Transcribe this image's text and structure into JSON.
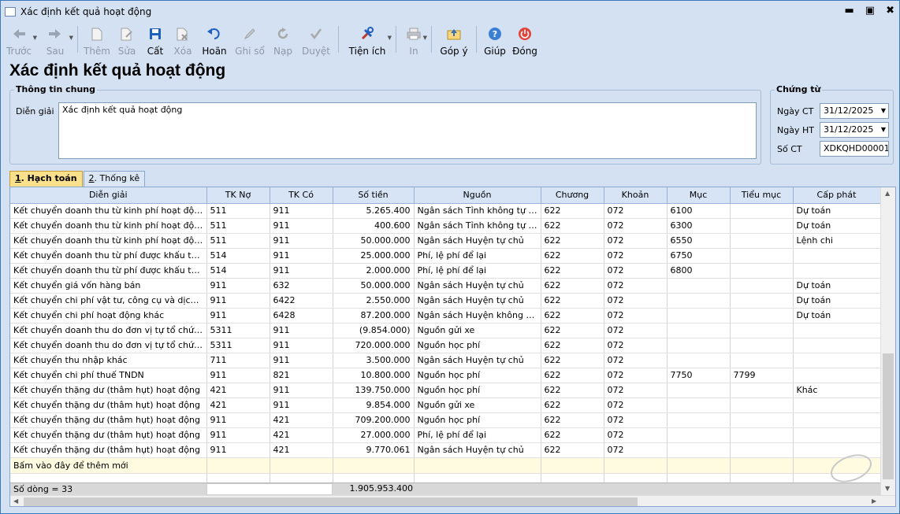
{
  "window": {
    "title": "Xác định kết quả hoạt động"
  },
  "toolbar": {
    "back": "Trước",
    "next": "Sau",
    "add": "Thêm",
    "edit": "Sửa",
    "save": "Cất",
    "delete": "Xóa",
    "undo": "Hoãn",
    "post": "Ghi sổ",
    "load": "Nạp",
    "approve": "Duyệt",
    "utilities": "Tiện ích",
    "print": "In",
    "feedback": "Góp ý",
    "help": "Giúp",
    "close": "Đóng"
  },
  "page": {
    "title": "Xác định kết quả hoạt động"
  },
  "general": {
    "legend": "Thông tin chung",
    "desc_label": "Diễn giải",
    "desc_value": "Xác định kết quả hoạt động"
  },
  "voucher": {
    "legend": "Chứng từ",
    "date_ct_label": "Ngày CT",
    "date_ct": "31/12/2025",
    "date_ht_label": "Ngày HT",
    "date_ht": "31/12/2025",
    "no_label": "Số CT",
    "no": "XDKQHD00001"
  },
  "tabs": [
    {
      "key": "1",
      "label": ". Hạch toán"
    },
    {
      "key": "2",
      "label": ". Thống kê"
    }
  ],
  "grid": {
    "columns": [
      "Diễn giải",
      "TK Nợ",
      "TK Có",
      "Số tiền",
      "Nguồn",
      "Chương",
      "Khoản",
      "Mục",
      "Tiểu mục",
      "Cấp phát"
    ],
    "rows": [
      [
        "Kết chuyển doanh thu từ kinh phí hoạt động N...",
        "511",
        "911",
        "5.265.400",
        "Ngân sách Tỉnh không tự chủ",
        "622",
        "072",
        "6100",
        "",
        "Dự toán"
      ],
      [
        "Kết chuyển doanh thu từ kinh phí hoạt động N...",
        "511",
        "911",
        "400.600",
        "Ngân sách Tỉnh không tự chủ",
        "622",
        "072",
        "6300",
        "",
        "Dự toán"
      ],
      [
        "Kết chuyển doanh thu từ kinh phí hoạt động N...",
        "511",
        "911",
        "50.000.000",
        "Ngân sách Huyện tự chủ",
        "622",
        "072",
        "6550",
        "",
        "Lệnh chi"
      ],
      [
        "Kết chuyển doanh thu từ phí được khấu trừ, để...",
        "514",
        "911",
        "25.000.000",
        "Phí, lệ phí để lại",
        "622",
        "072",
        "6750",
        "",
        ""
      ],
      [
        "Kết chuyển doanh thu từ phí được khấu trừ, để...",
        "514",
        "911",
        "2.000.000",
        "Phí, lệ phí để lại",
        "622",
        "072",
        "6800",
        "",
        ""
      ],
      [
        "Kết chuyển giá vốn hàng bán",
        "911",
        "632",
        "50.000.000",
        "Ngân sách Huyện tự chủ",
        "622",
        "072",
        "",
        "",
        "Dự toán"
      ],
      [
        "Kết chuyển chi phí vật tư, công cụ và dịch vụ đ...",
        "911",
        "6422",
        "2.550.000",
        "Ngân sách Huyện tự chủ",
        "622",
        "072",
        "",
        "",
        "Dự toán"
      ],
      [
        "Kết chuyển chi phí hoạt động khác",
        "911",
        "6428",
        "87.200.000",
        "Ngân sách Huyện không tự c...",
        "622",
        "072",
        "",
        "",
        "Dự toán"
      ],
      [
        "Kết chuyển doanh thu do đơn vị tự tổ chức thu",
        "5311",
        "911",
        "(9.854.000)",
        "Nguồn gửi xe",
        "622",
        "072",
        "",
        "",
        ""
      ],
      [
        "Kết chuyển doanh thu do đơn vị tự tổ chức thu",
        "5311",
        "911",
        "720.000.000",
        "Nguồn học phí",
        "622",
        "072",
        "",
        "",
        ""
      ],
      [
        "Kết chuyển thu nhập khác",
        "711",
        "911",
        "3.500.000",
        "Ngân sách Huyện tự chủ",
        "622",
        "072",
        "",
        "",
        ""
      ],
      [
        "Kết chuyển chi phí thuế TNDN",
        "911",
        "821",
        "10.800.000",
        "Nguồn học phí",
        "622",
        "072",
        "7750",
        "7799",
        ""
      ],
      [
        "Kết chuyển thặng dư (thâm hụt) hoạt động",
        "421",
        "911",
        "139.750.000",
        "Nguồn học phí",
        "622",
        "072",
        "",
        "",
        "Khác"
      ],
      [
        "Kết chuyển thặng dư (thâm hụt) hoạt động",
        "421",
        "911",
        "9.854.000",
        "Nguồn gửi xe",
        "622",
        "072",
        "",
        "",
        ""
      ],
      [
        "Kết chuyển thặng dư (thâm hụt) hoạt động",
        "911",
        "421",
        "709.200.000",
        "Nguồn học phí",
        "622",
        "072",
        "",
        "",
        ""
      ],
      [
        "Kết chuyển thặng dư (thâm hụt) hoạt động",
        "911",
        "421",
        "27.000.000",
        "Phí, lệ phí để lại",
        "622",
        "072",
        "",
        "",
        ""
      ],
      [
        "Kết chuyển thặng dư (thâm hụt) hoạt động",
        "911",
        "421",
        "9.770.061",
        "Ngân sách Huyện tự chủ",
        "622",
        "072",
        "",
        "",
        ""
      ]
    ],
    "new_row": "Bấm vào đây để thêm mới",
    "row_count": "Số dòng = 33",
    "total": "1.905.953.400"
  },
  "colors": {
    "window_bg": "#d4e1f2",
    "header_bg": "#d7e4f5",
    "active_tab": "#fbe08c",
    "new_row_bg": "#fefbe1"
  }
}
